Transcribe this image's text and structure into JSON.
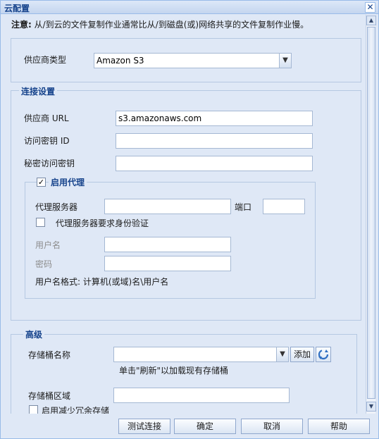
{
  "title": "云配置",
  "note": {
    "label": "注意:",
    "text": " 从/到云的文件复制作业通常比从/到磁盘(或)网络共享的文件复制作业慢。"
  },
  "provider": {
    "label": "供应商类型",
    "value": "Amazon S3"
  },
  "connection": {
    "legend": "连接设置",
    "url_label": "供应商 URL",
    "url_value": "s3.amazonaws.com",
    "access_key_label": "访问密钥 ID",
    "access_key_value": "",
    "secret_key_label": "秘密访问密钥",
    "secret_key_value": ""
  },
  "proxy": {
    "legend": "启用代理",
    "enabled": true,
    "server_label": "代理服务器",
    "port_label": "端口",
    "auth_label": "代理服务器要求身份验证",
    "auth_checked": false,
    "username_label": "用户名",
    "password_label": "密码",
    "format_hint": "用户名格式: 计算机(或域)名\\用户名"
  },
  "advanced": {
    "legend": "高级",
    "bucket_label": "存储桶名称",
    "bucket_value": "",
    "add_label": "添加",
    "refresh_hint": "单击\"刷新\"以加载现有存储桶",
    "region_label": "存储桶区域",
    "region_value": "",
    "reduced_redundancy_label": "启用减少冗余存储",
    "reduced_redundancy_checked": false
  },
  "buttons": {
    "test": "测试连接",
    "ok": "确定",
    "cancel": "取消",
    "help": "帮助"
  },
  "icons": {
    "close": "close-icon",
    "dropdown": "chevron-down-icon",
    "refresh": "refresh-icon",
    "check": "checkmark-icon"
  },
  "colors": {
    "title_text": "#15428b",
    "background": "#dfe8f6",
    "border": "#99bbe8"
  }
}
